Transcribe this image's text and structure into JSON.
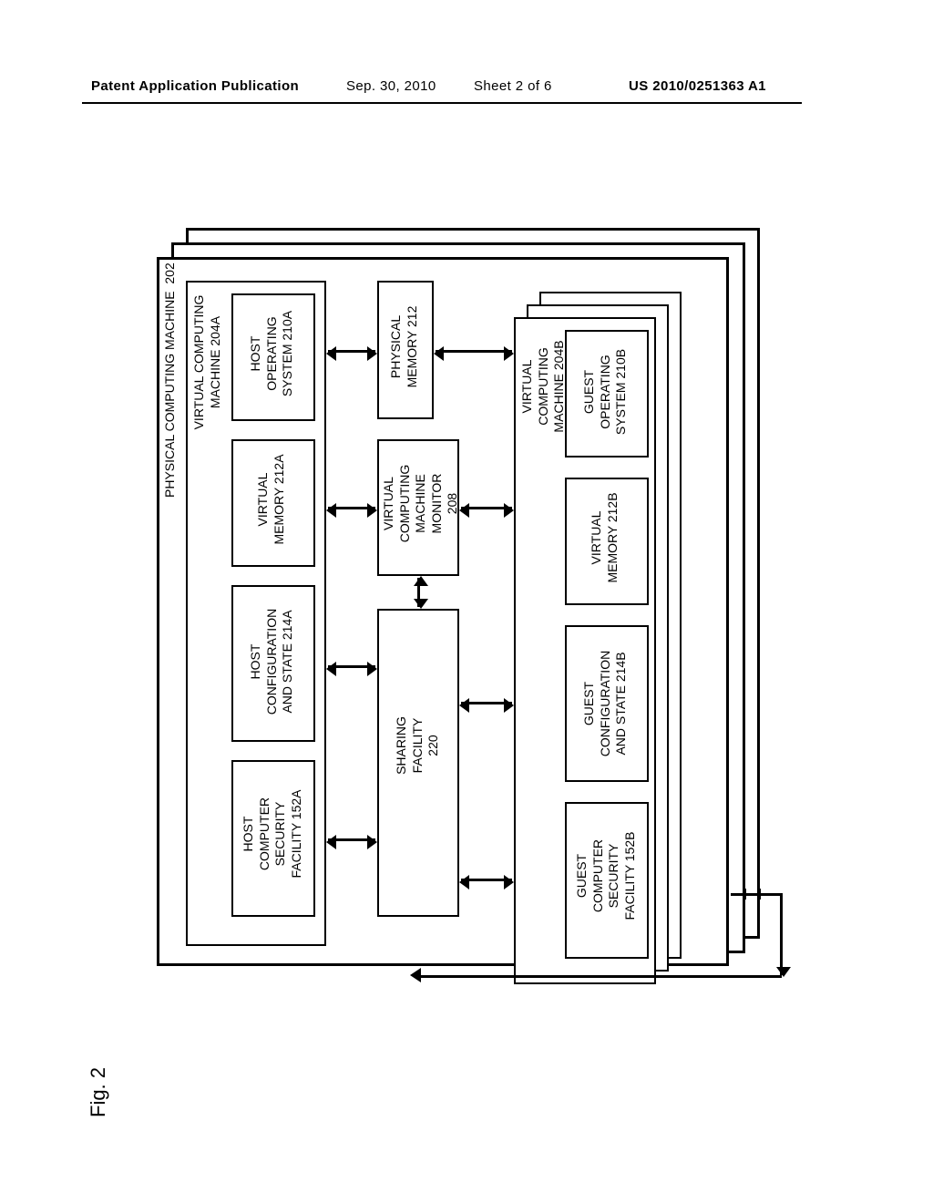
{
  "header": {
    "publication": "Patent Application Publication",
    "date": "Sep. 30, 2010",
    "sheet": "Sheet 2 of 6",
    "number": "US 2010/0251363 A1"
  },
  "figure_label": "Fig. 2",
  "labels": {
    "physical_machine": "PHYSICAL COMPUTING MACHINE  202",
    "host_vm": "VIRTUAL COMPUTING\nMACHINE 204A",
    "host_os": "HOST\nOPERATING\nSYSTEM 210A",
    "host_vmem": "VIRTUAL\nMEMORY 212A",
    "host_cfg": "HOST\nCONFIGURATION\nAND STATE 214A",
    "host_sec": "HOST\nCOMPUTER\nSECURITY\nFACILITY 152A",
    "phys_mem": "PHYSICAL\nMEMORY 212",
    "vmm": "VIRTUAL\nCOMPUTING\nMACHINE\nMONITOR\n208",
    "sharing": "SHARING\nFACILITY\n220",
    "guest_vm": "VIRTUAL\nCOMPUTING\nMACHINE 204B",
    "guest_os": "GUEST\nOPERATING\nSYSTEM 210B",
    "guest_vmem": "VIRTUAL\nMEMORY 212B",
    "guest_cfg": "GUEST\nCONFIGURATION\nAND STATE 214B",
    "guest_sec": "GUEST\nCOMPUTER\nSECURITY\nFACILITY 152B"
  }
}
